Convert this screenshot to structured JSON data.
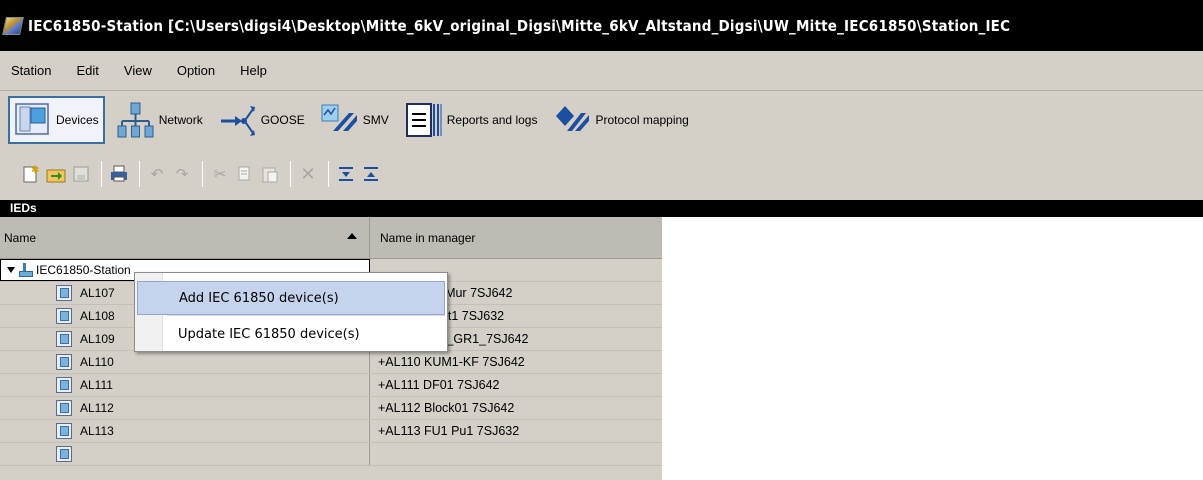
{
  "window": {
    "title": "IEC61850-Station [C:\\Users\\digsi4\\Desktop\\Mitte_6kV_original_Digsi\\Mitte_6kV_Altstand_Digsi\\UW_Mitte_IEC61850\\Station_IEC"
  },
  "menu": [
    "Station",
    "Edit",
    "View",
    "Option",
    "Help"
  ],
  "views": [
    {
      "label": "Devices",
      "icon": "devices-icon",
      "active": true
    },
    {
      "label": "Network",
      "icon": "network-icon"
    },
    {
      "label": "GOOSE",
      "icon": "goose-icon"
    },
    {
      "label": "SMV",
      "icon": "smv-icon"
    },
    {
      "label": "Reports and logs",
      "icon": "reports-icon"
    },
    {
      "label": "Protocol mapping",
      "icon": "protocol-mapping-icon"
    }
  ],
  "toolbar_icons": [
    "new-icon",
    "import-icon",
    "save-icon",
    "print-icon",
    "undo-icon",
    "redo-icon",
    "cut-icon",
    "copy-icon",
    "paste-icon",
    "delete-icon",
    "expand-all-icon",
    "collapse-all-icon"
  ],
  "panel": {
    "title": "IEDs",
    "columns": [
      "Name",
      "Name in manager"
    ],
    "root": "IEC61850-Station",
    "rows": [
      {
        "name": "AL107",
        "manager": "+AL107 SV Mur 7SJ642"
      },
      {
        "name": "AL108",
        "manager": "+AL108 Kraft1 7SJ632"
      },
      {
        "name": "AL109",
        "manager": "+AL109_GK_GR1_7SJ642"
      },
      {
        "name": "AL110",
        "manager": "+AL110 KUM1-KF 7SJ642"
      },
      {
        "name": "AL111",
        "manager": "+AL111 DF01 7SJ642"
      },
      {
        "name": "AL112",
        "manager": "+AL112 Block01 7SJ642"
      },
      {
        "name": "AL113",
        "manager": "+AL113 FU1 Pu1 7SJ632"
      }
    ]
  },
  "context_menu": {
    "items": [
      "Add IEC 61850 device(s)",
      "Update IEC 61850 device(s)"
    ]
  }
}
